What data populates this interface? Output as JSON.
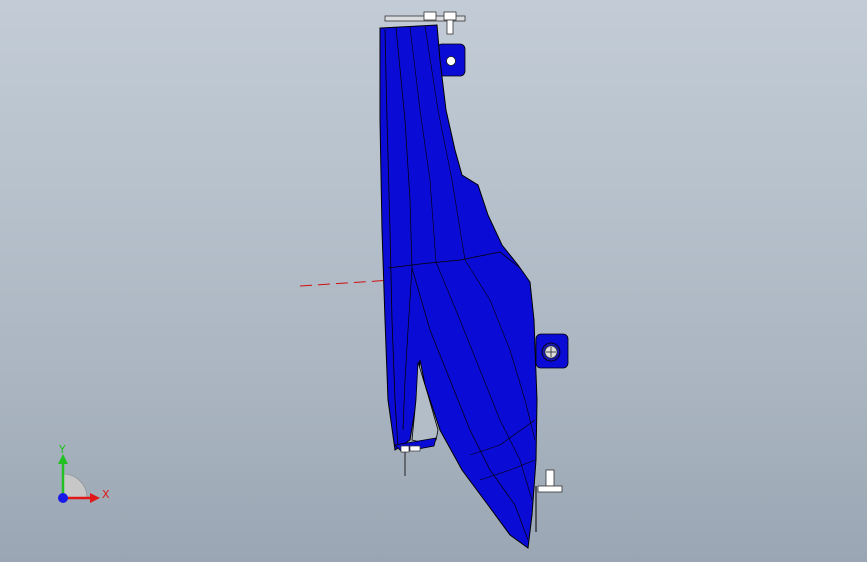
{
  "viewport": {
    "background_top": "#c3ccd6",
    "background_bottom": "#9aa6b3"
  },
  "model": {
    "part_color": "#0b0bd6",
    "edge_color": "#000000",
    "highlight_color": "#2424ff",
    "fastener_color": "#ffffff",
    "sketch_line_color": "#d01010"
  },
  "triad": {
    "x_label": "X",
    "y_label": "Y",
    "x_color": "#e01818",
    "y_color": "#22c022",
    "z_color": "#1a1ae6"
  }
}
